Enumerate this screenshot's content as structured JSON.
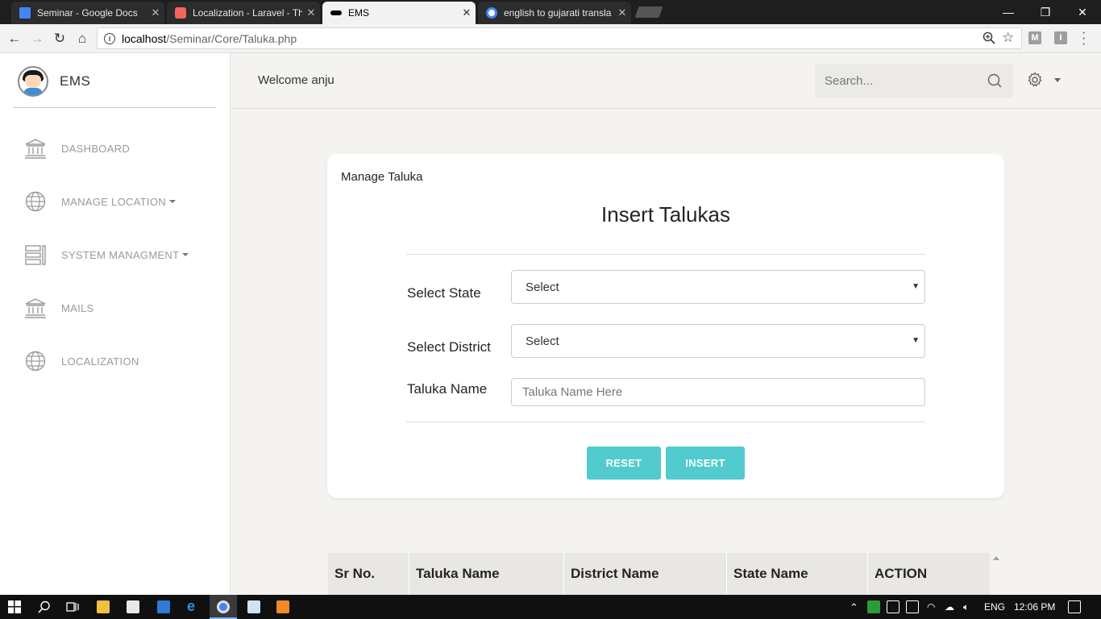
{
  "browser": {
    "tabs": [
      {
        "title": "Seminar - Google Docs",
        "active": false
      },
      {
        "title": "Localization - Laravel - Th",
        "active": false
      },
      {
        "title": "EMS",
        "active": true
      },
      {
        "title": "english to gujarati transla",
        "active": false
      }
    ],
    "url_host": "localhost",
    "url_path": "/Seminar/Core/Taluka.php",
    "extensions": [
      "M",
      "I"
    ]
  },
  "sidebar": {
    "brand": "EMS",
    "items": [
      {
        "label": "DASHBOARD",
        "icon": "bank-icon",
        "dropdown": false
      },
      {
        "label": "MANAGE LOCATION",
        "icon": "globe-icon",
        "dropdown": true
      },
      {
        "label": "SYSTEM MANAGMENT",
        "icon": "layout-icon",
        "dropdown": true
      },
      {
        "label": "MAILS",
        "icon": "bank-icon",
        "dropdown": false
      },
      {
        "label": "LOCALIZATION",
        "icon": "globe-icon",
        "dropdown": false
      }
    ]
  },
  "header": {
    "welcome": "Welcome anju",
    "search_placeholder": "Search..."
  },
  "form": {
    "card_label": "Manage Taluka",
    "title": "Insert Talukas",
    "state_label": "Select State",
    "state_value": "Select",
    "district_label": "Select District",
    "district_value": "Select",
    "taluka_label": "Taluka Name",
    "taluka_placeholder": "Taluka Name Here",
    "reset_label": "RESET",
    "insert_label": "INSERT"
  },
  "table": {
    "headers": [
      "Sr No.",
      "Taluka Name",
      "District Name",
      "State Name",
      "ACTION"
    ]
  },
  "taskbar": {
    "language": "ENG",
    "time": "12:06 PM"
  },
  "colors": {
    "accent": "#51cbce",
    "sidebar_text": "#9a9a9a",
    "background": "#f4f3ef"
  }
}
